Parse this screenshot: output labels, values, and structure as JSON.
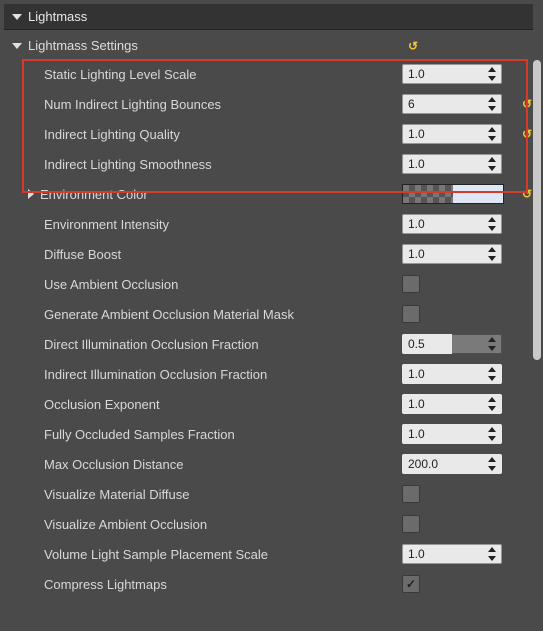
{
  "section": {
    "title": "Lightmass"
  },
  "subsection": {
    "title": "Lightmass Settings"
  },
  "rows": {
    "static_lighting_level_scale": {
      "label": "Static Lighting Level Scale",
      "value": "1.0",
      "type": "spin",
      "enabled": true,
      "reset": false
    },
    "num_indirect_bounces": {
      "label": "Num Indirect Lighting Bounces",
      "value": "6",
      "type": "spin",
      "enabled": true,
      "reset": true
    },
    "indirect_lighting_quality": {
      "label": "Indirect Lighting Quality",
      "value": "1.0",
      "type": "spin",
      "enabled": true,
      "reset": true
    },
    "indirect_lighting_smoothness": {
      "label": "Indirect Lighting Smoothness",
      "value": "1.0",
      "type": "spin",
      "enabled": true,
      "reset": false
    },
    "environment_color": {
      "label": "Environment Color",
      "value": "",
      "type": "color",
      "enabled": true,
      "reset": true
    },
    "environment_intensity": {
      "label": "Environment Intensity",
      "value": "1.0",
      "type": "spin",
      "enabled": true,
      "reset": false
    },
    "diffuse_boost": {
      "label": "Diffuse Boost",
      "value": "1.0",
      "type": "spin",
      "enabled": true,
      "reset": false
    },
    "use_ambient_occlusion": {
      "label": "Use Ambient Occlusion",
      "value": false,
      "type": "check",
      "enabled": true,
      "reset": false
    },
    "generate_ao_material_mask": {
      "label": "Generate Ambient Occlusion Material Mask",
      "value": false,
      "type": "check",
      "enabled": true,
      "reset": false
    },
    "direct_illum_occ_fraction": {
      "label": "Direct Illumination Occlusion Fraction",
      "value": "0.5",
      "type": "spin",
      "enabled": false,
      "fill_pct": 50,
      "reset": false
    },
    "indirect_illum_occ_fraction": {
      "label": "Indirect Illumination Occlusion Fraction",
      "value": "1.0",
      "type": "spin",
      "enabled": false,
      "reset": false
    },
    "occlusion_exponent": {
      "label": "Occlusion Exponent",
      "value": "1.0",
      "type": "spin",
      "enabled": false,
      "reset": false
    },
    "fully_occluded_fraction": {
      "label": "Fully Occluded Samples Fraction",
      "value": "1.0",
      "type": "spin",
      "enabled": false,
      "reset": false
    },
    "max_occ_distance": {
      "label": "Max Occlusion Distance",
      "value": "200.0",
      "type": "spin",
      "enabled": false,
      "reset": false
    },
    "visualize_material_diffuse": {
      "label": "Visualize Material Diffuse",
      "value": false,
      "type": "check",
      "enabled": true,
      "reset": false
    },
    "visualize_ambient_occlusion": {
      "label": "Visualize Ambient Occlusion",
      "value": false,
      "type": "check",
      "enabled": true,
      "reset": false
    },
    "volume_sample_scale": {
      "label": "Volume Light Sample Placement Scale",
      "value": "1.0",
      "type": "spin",
      "enabled": true,
      "reset": false
    },
    "compress_lightmaps": {
      "label": "Compress Lightmaps",
      "value": true,
      "type": "check",
      "enabled": true,
      "reset": false
    }
  }
}
